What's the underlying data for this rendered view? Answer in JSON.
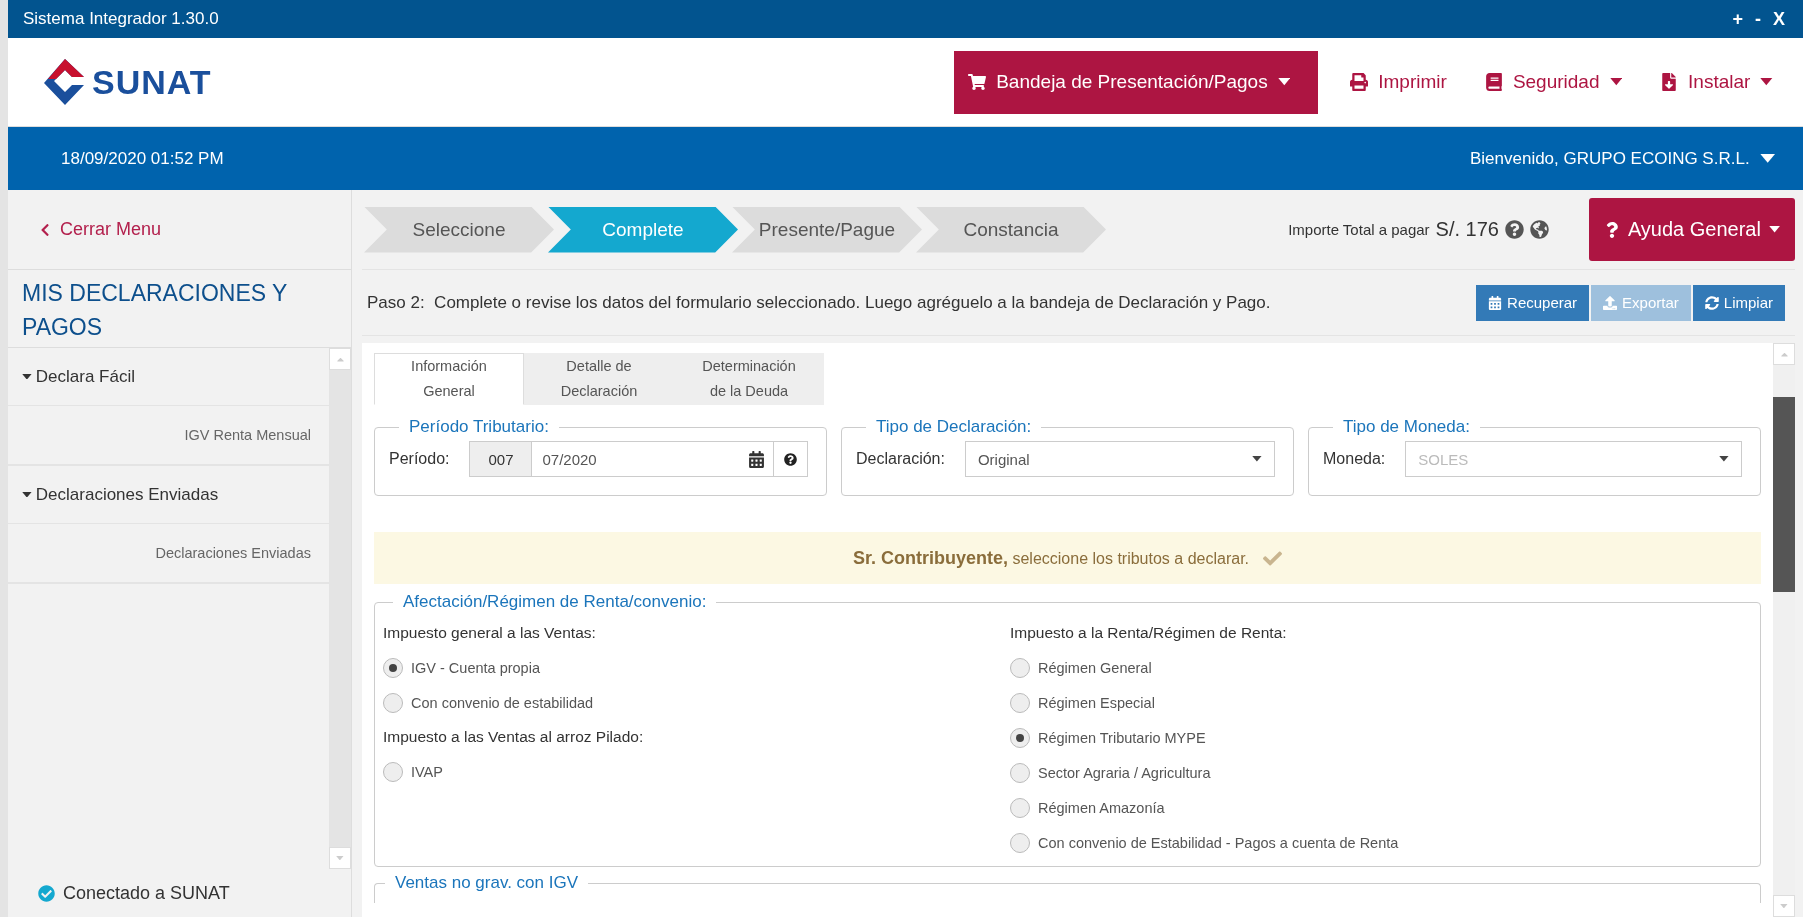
{
  "window": {
    "title": "Sistema Integrador 1.30.0",
    "controls": [
      "+",
      "-",
      "X"
    ]
  },
  "header": {
    "logo": "SUNAT",
    "menu": [
      {
        "label": "Bandeja de Presentación/Pagos",
        "kind": "primary",
        "dropdown": true
      },
      {
        "label": "Imprimir",
        "kind": "link",
        "dropdown": false
      },
      {
        "label": "Seguridad",
        "kind": "link",
        "dropdown": true
      },
      {
        "label": "Instalar",
        "kind": "link",
        "dropdown": true
      }
    ]
  },
  "info_bar": {
    "datetime": "18/09/2020 01:52 PM",
    "welcome": "Bienvenido, GRUPO ECOING S.R.L."
  },
  "sidebar": {
    "close_menu": "Cerrar Menu",
    "title": "MIS DECLARACIONES Y PAGOS",
    "groups": [
      {
        "label": "Declara Fácil",
        "expanded": true,
        "children": [
          {
            "label": "IGV Renta Mensual"
          }
        ]
      },
      {
        "label": "Declaraciones Enviadas",
        "expanded": true,
        "children": [
          {
            "label": "Declaraciones Enviadas"
          }
        ]
      }
    ],
    "status": "Conectado a SUNAT"
  },
  "steps": [
    {
      "label": "Seleccione",
      "selected": false
    },
    {
      "label": "Complete",
      "selected": true
    },
    {
      "label": "Presente/Pague",
      "selected": false
    },
    {
      "label": "Constancia",
      "selected": false
    }
  ],
  "total": {
    "label": "Importe Total a pagar",
    "amount": "S/. 176"
  },
  "help_button": "Ayuda General",
  "instruction": {
    "step": "Paso 2:",
    "text": "Complete o revise los datos del formulario seleccionado. Luego agréguelo a la bandeja de Declaración y Pago."
  },
  "actions": [
    {
      "label": "Recuperar",
      "disabled": false
    },
    {
      "label": "Exportar",
      "disabled": true
    },
    {
      "label": "Limpiar",
      "disabled": false
    }
  ],
  "form_tabs": [
    {
      "label": "Información General",
      "selected": true
    },
    {
      "label": "Detalle de Declaración",
      "selected": false
    },
    {
      "label": "Determinación de la Deuda",
      "selected": false
    }
  ],
  "fieldsets": [
    {
      "legend": "Período Tributario:",
      "label": "Período:",
      "kind": "period",
      "code": "007",
      "value": "07/2020",
      "disabled": false
    },
    {
      "legend": "Tipo de Declaración:",
      "label": "Declaración:",
      "kind": "select",
      "value": "Original",
      "disabled": false
    },
    {
      "legend": "Tipo de Moneda:",
      "label": "Moneda:",
      "kind": "select",
      "value": "SOLES",
      "disabled": true
    }
  ],
  "notice": {
    "text": "**Sr. Contribuyente,** seleccione los tributos a declarar."
  },
  "regimen": {
    "legend": "Afectación/Régimen de Renta/convenio:",
    "columns": [
      {
        "groups": [
          {
            "heading": "Impuesto general a las Ventas:",
            "options": [
              {
                "label": "IGV - Cuenta propia",
                "selected": true
              },
              {
                "label": "Con convenio de estabilidad",
                "selected": false
              }
            ]
          },
          {
            "heading": "Impuesto a las Ventas al arroz Pilado:",
            "options": [
              {
                "label": "IVAP",
                "selected": false
              }
            ]
          }
        ]
      },
      {
        "groups": [
          {
            "heading": "Impuesto a la Renta/Régimen de Renta:",
            "options": [
              {
                "label": "Régimen General",
                "selected": false
              },
              {
                "label": "Régimen Especial",
                "selected": false
              },
              {
                "label": "Régimen Tributario MYPE",
                "selected": true
              },
              {
                "label": "Sector Agraria / Agricultura",
                "selected": false
              },
              {
                "label": "Régimen Amazonía",
                "selected": false
              },
              {
                "label": "Con convenio de Estabilidad - Pagos a cuenta de Renta",
                "selected": false
              }
            ]
          }
        ]
      }
    ]
  },
  "next_section": {
    "legend": "Ventas no grav. con IGV"
  }
}
